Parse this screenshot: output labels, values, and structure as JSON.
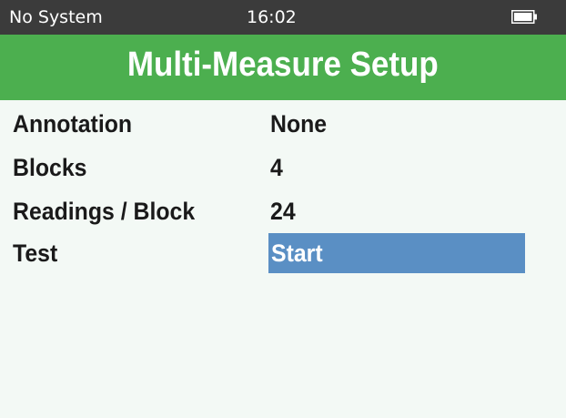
{
  "status_bar": {
    "system": "No System",
    "time": "16:02",
    "battery_icon": "battery-full-icon"
  },
  "header": {
    "title": "Multi-Measure Setup"
  },
  "settings": [
    {
      "label": "Annotation",
      "value": "None",
      "selected": false
    },
    {
      "label": "Blocks",
      "value": "4",
      "selected": false
    },
    {
      "label": "Readings / Block",
      "value": "24",
      "selected": false
    },
    {
      "label": "Test",
      "value": "Start",
      "selected": true
    }
  ],
  "colors": {
    "status_bar_bg": "#3b3b3b",
    "title_bar_bg": "#4caf4f",
    "screen_bg": "#f3f9f5",
    "selection_bg": "#5a8fc4",
    "text": "#1a1a1a"
  }
}
